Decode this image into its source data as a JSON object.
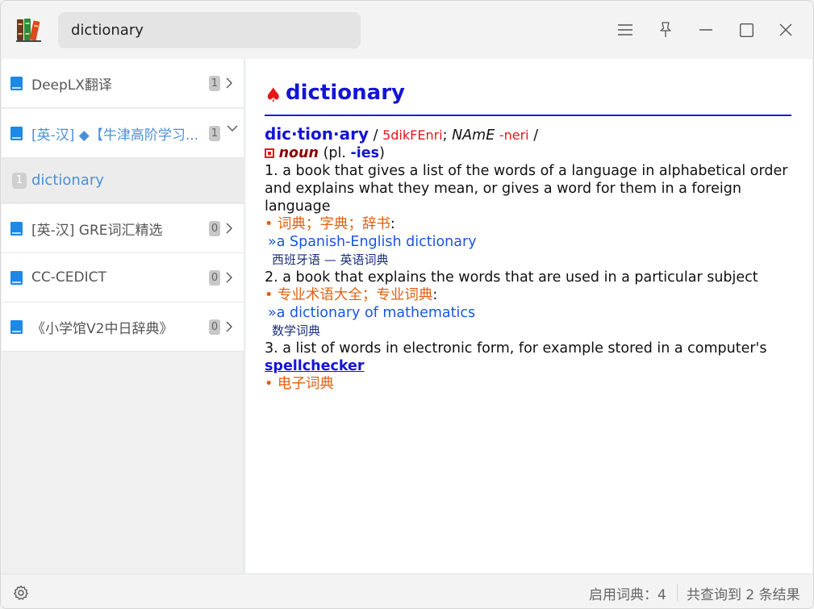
{
  "search": {
    "value": "dictionary"
  },
  "sidebar": {
    "items": [
      {
        "label": "DeepLX翻译",
        "count": "1",
        "icon": "chevron-right-icon"
      },
      {
        "label": "[英-汉] ◆【牛津高阶学习...",
        "count": "1",
        "icon": "chevron-down-icon",
        "active": true
      },
      {
        "label": "[英-汉] GRE词汇精选",
        "count": "0",
        "icon": "chevron-right-icon"
      },
      {
        "label": "CC-CEDICT",
        "count": "0",
        "icon": "chevron-right-icon"
      },
      {
        "label": "《小学馆V2中日辞典》",
        "count": "0",
        "icon": "chevron-right-icon"
      }
    ],
    "word": {
      "count": "1",
      "label": "dictionary"
    }
  },
  "entry": {
    "title": "dictionary",
    "headword": "dic·tion·ary",
    "slash": "/",
    "pron1": "5dikFEnri",
    "semi": ";",
    "region": "NAmE",
    "pron2": "-neri",
    "slash2": "/",
    "pos": "noun",
    "plural_prefix": "(pl.",
    "plural": "-ies",
    "plural_suffix": ")",
    "senses": [
      {
        "def": "1. a book that gives a list of the words of a language in alphabetical order and explains what they mean, or gives a word for them in a foreign language",
        "zh": "• 词典；字典；辞书",
        "ex": "»a Spanish-English dictionary",
        "ex_zh": "西班牙语 — 英语词典"
      },
      {
        "def": "2. a book that explains the words that are used in a particular subject",
        "zh": "• 专业术语大全；专业词典",
        "ex": "»a dictionary of mathematics",
        "ex_zh": "数学词典"
      },
      {
        "def": "3. a list of words in electronic form, for example stored in a computer's",
        "link": "spellchecker",
        "zh": "• 电子词典"
      }
    ]
  },
  "status": {
    "enabled": "启用词典：4",
    "results": "共查询到 2 条结果"
  },
  "colors": {
    "accent": "#1414d6",
    "red": "#e8141b",
    "chinese": "#e06010",
    "sidebar_active": "#4a90d9"
  }
}
